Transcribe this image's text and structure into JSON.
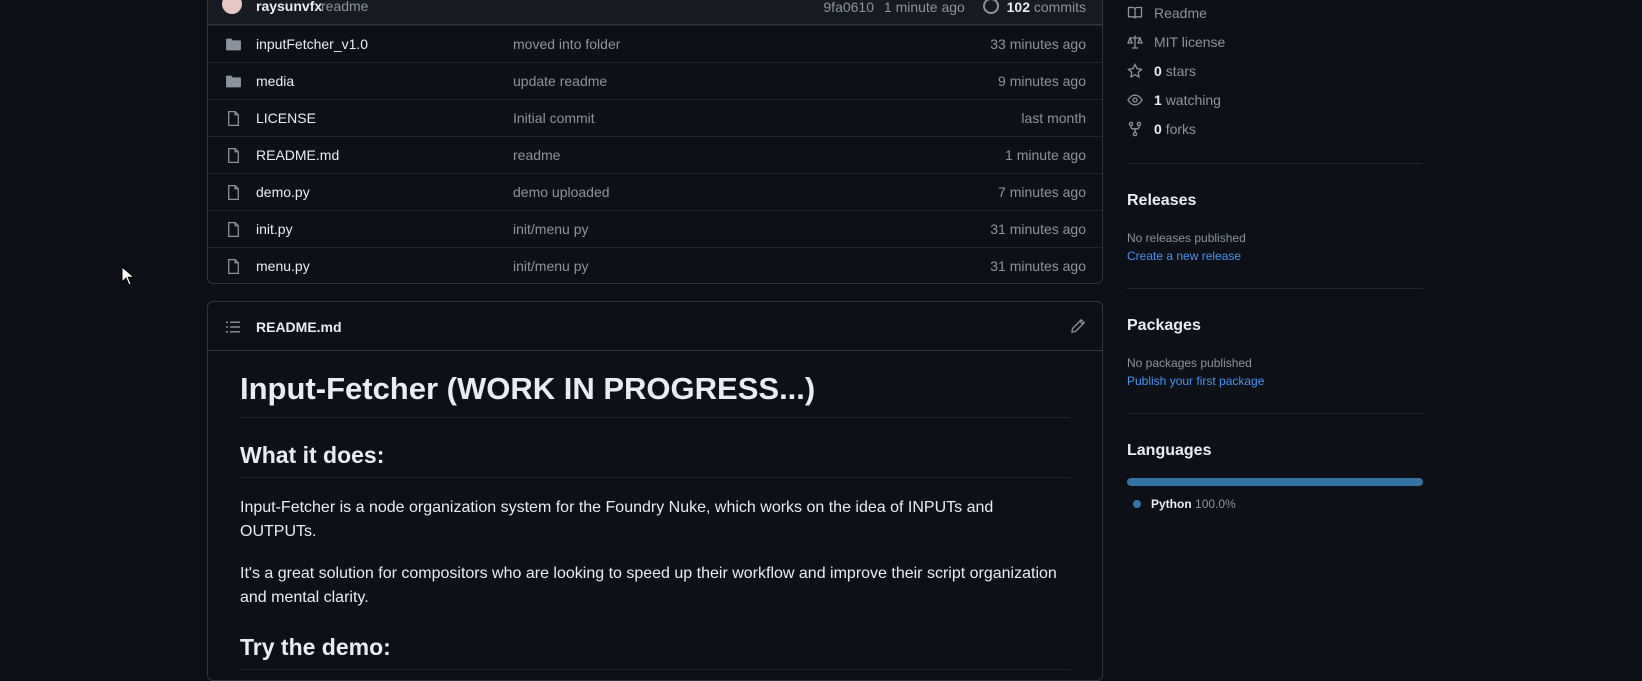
{
  "latest_commit": {
    "author": "raysunvfx",
    "message": "readme",
    "hash": "9fa0610",
    "time": "1 minute ago",
    "commits_count": "102",
    "commits_label": "commits"
  },
  "files": [
    {
      "name": "inputFetcher_v1.0",
      "type": "folder",
      "message": "moved into folder",
      "age": "33 minutes ago"
    },
    {
      "name": "media",
      "type": "folder",
      "message": "update readme",
      "age": "9 minutes ago"
    },
    {
      "name": "LICENSE",
      "type": "file",
      "message": "Initial commit",
      "age": "last month"
    },
    {
      "name": "README.md",
      "type": "file",
      "message": "readme",
      "age": "1 minute ago"
    },
    {
      "name": "demo.py",
      "type": "file",
      "message": "demo uploaded",
      "age": "7 minutes ago"
    },
    {
      "name": "init.py",
      "type": "file",
      "message": "init/menu py",
      "age": "31 minutes ago"
    },
    {
      "name": "menu.py",
      "type": "file",
      "message": "init/menu py",
      "age": "31 minutes ago"
    }
  ],
  "readme": {
    "header_title": "README.md",
    "h1": "Input-Fetcher (WORK IN PROGRESS...)",
    "h2_what": "What it does:",
    "p1": "Input-Fetcher is a node organization system for the Foundry Nuke, which works on the idea of INPUTs and OUTPUTs.",
    "p2": "It's a great solution for compositors who are looking to speed up their workflow and improve their script organization and mental clarity.",
    "h2_demo": "Try the demo:"
  },
  "sidebar": {
    "about": {
      "readme": "Readme",
      "license": "MIT license",
      "stars_count": "0",
      "stars_label": "stars",
      "watching_count": "1",
      "watching_label": "watching",
      "forks_count": "0",
      "forks_label": "forks"
    },
    "releases": {
      "title": "Releases",
      "none": "No releases published",
      "link": "Create a new release"
    },
    "packages": {
      "title": "Packages",
      "none": "No packages published",
      "link": "Publish your first package"
    },
    "languages": {
      "title": "Languages",
      "items": [
        {
          "name": "Python",
          "percent": "100.0%",
          "color": "#3572A5"
        }
      ]
    }
  },
  "colors": {
    "background": "#0d1117",
    "border": "#30363d",
    "muted": "#8b949e",
    "link": "#4493f8",
    "python": "#3572A5"
  }
}
